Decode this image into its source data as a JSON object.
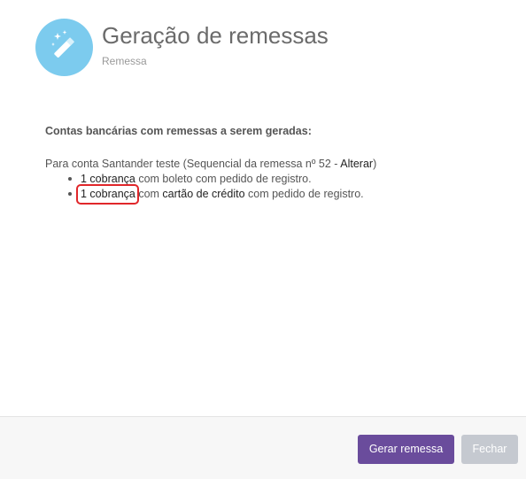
{
  "header": {
    "title": "Geração de remessas",
    "subtitle": "Remessa",
    "icon": "magic-wand-icon",
    "icon_color": "#7ccbee"
  },
  "content": {
    "heading": "Contas bancárias com remessas a serem geradas:",
    "account": {
      "prefix": "Para conta Santander teste (Sequencial da remessa nº 52 - ",
      "link_label": "Alterar",
      "suffix": ")"
    },
    "items": [
      {
        "count_label": "1 cobrança",
        "middle": " com boleto com pedido de registro."
      },
      {
        "count_label": "1 cobrança",
        "middle": " com ",
        "method_label": "cartão de crédito",
        "suffix": " com pedido de registro."
      }
    ],
    "highlight_color": "#e0262a"
  },
  "footer": {
    "primary_button": "Gerar remessa",
    "close_button": "Fechar",
    "primary_color": "#6a4c9c",
    "close_color": "#c5c9d0"
  }
}
